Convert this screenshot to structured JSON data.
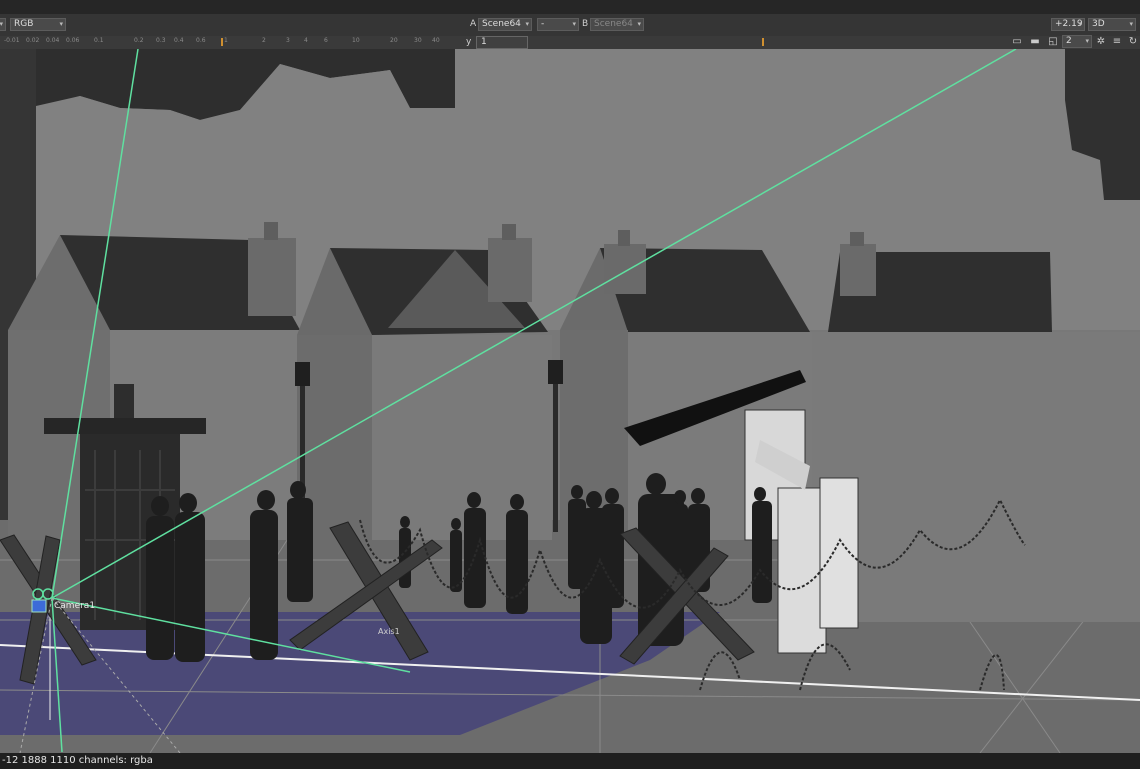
{
  "toolbar": {
    "channels_value": "RGB",
    "input_a_label": "A",
    "input_a_value": "Scene64",
    "dash_value": "-",
    "input_b_label": "B",
    "input_b_value": "Scene64",
    "gain_value": "+2.19",
    "view_mode": "3D",
    "y_label": "y",
    "y_value": "1",
    "viewer_number": "2"
  },
  "ruler": {
    "ticks": [
      "-0.01",
      "0.02",
      "0.04",
      "0.06",
      "0.1",
      "0.2",
      "0.3",
      "0.4",
      "0.6",
      "1",
      "2",
      "3",
      "4",
      "6",
      "10",
      "20",
      "30",
      "40"
    ]
  },
  "viewport": {
    "camera_label": "Camera1",
    "axis_label": "Axis1"
  },
  "status": {
    "text": "-12 1888 1110 channels: rgba"
  },
  "colors": {
    "frustum_line": "#5fe0a0",
    "ground_selection": "#4a4878",
    "background": "#777777"
  },
  "icons": [
    "channels-dropdown-arrow",
    "region-icon",
    "roi-icon",
    "overlay-icon",
    "settings-icon",
    "menu-icon",
    "refresh-icon"
  ]
}
